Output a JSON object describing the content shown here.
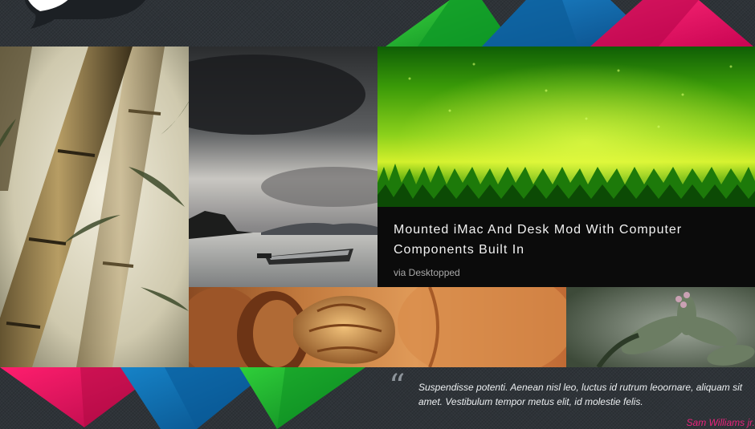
{
  "header": {
    "logo": "logo-speech-bubble"
  },
  "gallery": {
    "tiles": [
      {
        "subject": "bamboo",
        "icon": "bamboo-photo"
      },
      {
        "subject": "storm-boat",
        "icon": "storm-photo"
      },
      {
        "subject": "green-grass-rain",
        "icon": "grass-photo"
      },
      {
        "subject": "walnuts",
        "icon": "walnut-photo"
      },
      {
        "subject": "fuzzy-plant",
        "icon": "plant-photo"
      }
    ],
    "featured": {
      "title": "Mounted iMac And Desk Mod With Computer Components Built In",
      "source": "via Desktopped"
    }
  },
  "testimonial": {
    "quote_mark": "“",
    "text": "Suspendisse potenti. Aenean nisl leo, luctus id rutrum leoornare, aliquam sit amet. Vestibulum tempor metus elit, id molestie felis.",
    "author": "Sam Williams jr."
  },
  "colors": {
    "background": "#2e3338",
    "green": "#13a326",
    "blue": "#0a68a8",
    "pink": "#e8085f",
    "author": "#e8247c"
  }
}
